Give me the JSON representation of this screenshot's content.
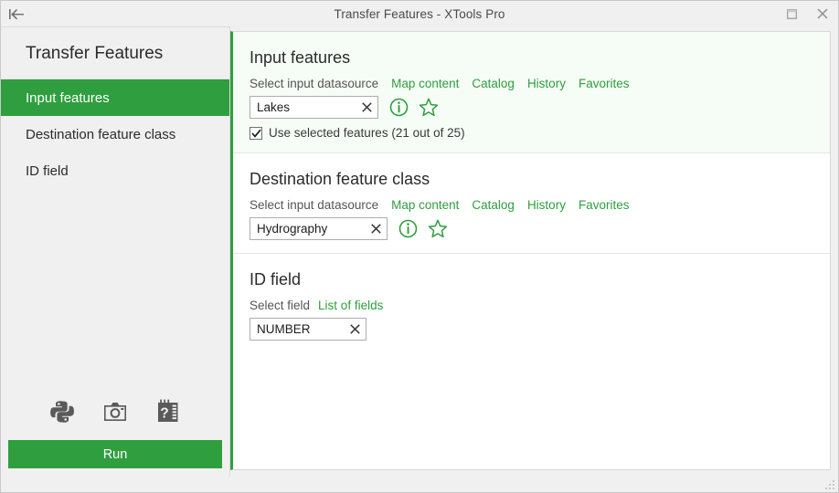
{
  "window": {
    "title": "Transfer Features - XTools Pro",
    "back_icon": "back-to-start-icon",
    "restore_icon": "restore-window-icon",
    "close_icon": "close-window-icon"
  },
  "sidebar": {
    "title": "Transfer Features",
    "items": [
      {
        "label": "Input features",
        "active": true
      },
      {
        "label": "Destination feature class",
        "active": false
      },
      {
        "label": "ID field",
        "active": false
      }
    ],
    "tools": [
      {
        "name": "python-icon",
        "tooltip": "Python"
      },
      {
        "name": "camera-icon",
        "tooltip": "Screenshot"
      },
      {
        "name": "help-icon",
        "tooltip": "Help"
      }
    ],
    "run_label": "Run"
  },
  "main": {
    "sections": [
      {
        "title": "Input features",
        "active": true,
        "label": "Select input datasource",
        "links": [
          "Map content",
          "Catalog",
          "History",
          "Favorites"
        ],
        "value": "Lakes",
        "placeholder": "Select input datasource",
        "info_icon": "info-icon",
        "favorite_icon": "star-icon",
        "clear_icon": "clear-icon",
        "checkbox": {
          "checked": true,
          "label": "Use selected features (21 out of 25)"
        }
      },
      {
        "title": "Destination feature class",
        "active": false,
        "label": "Select input datasource",
        "links": [
          "Map content",
          "Catalog",
          "History",
          "Favorites"
        ],
        "value": "Hydrography",
        "placeholder": "Select input datasource",
        "info_icon": "info-icon",
        "favorite_icon": "star-icon",
        "clear_icon": "clear-icon"
      },
      {
        "title": "ID field",
        "active": false,
        "label": "Select field",
        "links": [
          "List of fields"
        ],
        "value": "NUMBER",
        "placeholder": "Select field",
        "clear_icon": "clear-icon"
      }
    ]
  },
  "colors": {
    "accent_green": "#2f9e3f",
    "section_active_bg": "#f6fcf6",
    "chrome_bg": "#f0f0f0"
  }
}
